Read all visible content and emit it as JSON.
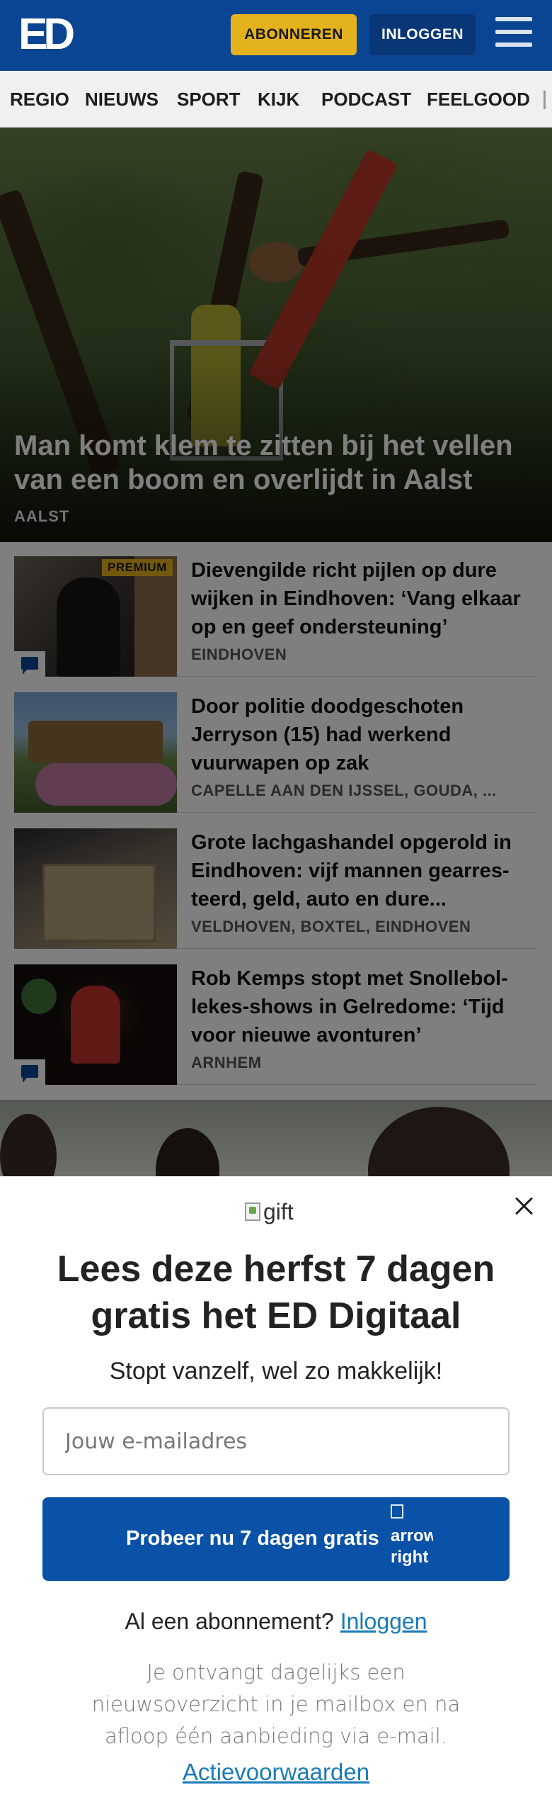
{
  "header": {
    "logo_text": "ED",
    "subscribe_label": "ABONNEREN",
    "login_label": "INLOGGEN",
    "menu_icon": "hamburger-menu-icon",
    "brand_color": "#0a4594",
    "accent_color": "#e4b21d"
  },
  "nav": {
    "items": [
      "REGIO",
      "NIEUWS",
      "SPORT",
      "KIJK",
      "PODCAST",
      "FEELGOOD"
    ]
  },
  "hero": {
    "title": "Man komt klem te zitten bij het vellen van een boom en overlijdt in Aalst",
    "location": "AALST"
  },
  "articles": [
    {
      "badge": "PREMIUM",
      "title": "Dievengilde richt pijlen op dure wijken in Eindhoven: ‘Vang elkaar op en geef ondersteuning’",
      "location": "EINDHOVEN",
      "has_comments": true
    },
    {
      "title": "Door politie doodgeschoten Jerryson (15) had werkend vuurwapen op zak",
      "location": "CAPELLE AAN DEN IJSSEL, GOUDA, ..."
    },
    {
      "title": "Grote lachgashandel opgerold in Eindhoven: vijf mannen gearres­teerd, geld, auto en dure...",
      "location": "VELDHOVEN, BOXTEL, EINDHOVEN"
    },
    {
      "title": "Rob Kemps stopt met Snollebol­lekes-shows in Gelredome: ‘Tijd voor nieuwe avonturen’",
      "location": "ARNHEM",
      "has_comments": true
    }
  ],
  "modal": {
    "gift_alt": "gift",
    "title": "Lees deze herfst 7 dagen gratis het ED Digitaal",
    "subtitle": "Stopt vanzelf, wel zo makkelijk!",
    "email_placeholder": "Jouw e-mailadres",
    "cta_label": "Probeer nu 7 dagen gratis",
    "cta_arrow_alt": "arrow right",
    "have_subscription_text": "Al een abonnement?",
    "login_link": "Inloggen",
    "info_text": "Je ontvangt dagelijks een nieuwsoverzicht in je mailbox en na afloop één aanbieding via e-mail.",
    "terms_link": "Actievoorwaarden",
    "close_icon": "close-icon"
  }
}
